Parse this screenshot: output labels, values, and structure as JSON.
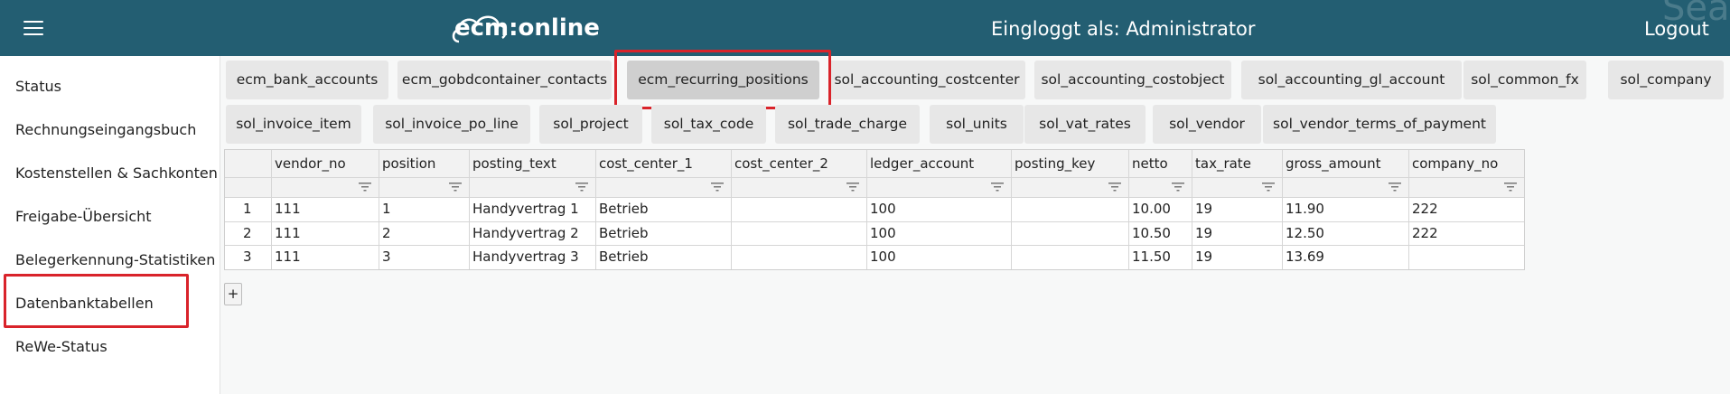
{
  "header": {
    "logo_text": "ecm:online",
    "logged_in": "Eingloggt als: Administrator",
    "logout_label": "Logout",
    "watermark": "Searchin"
  },
  "sidebar": {
    "items": [
      {
        "label": "Status"
      },
      {
        "label": "Rechnungseingangsbuch"
      },
      {
        "label": "Kostenstellen & Sachkonten"
      },
      {
        "label": "Freigabe-Übersicht"
      },
      {
        "label": "Belegerkennung-Statistiken"
      },
      {
        "label": "Datenbanktabellen"
      },
      {
        "label": "ReWe-Status"
      }
    ]
  },
  "tabs": {
    "row1": [
      {
        "label": "ecm_bank_accounts"
      },
      {
        "label": "ecm_gobdcontainer_contacts"
      },
      {
        "label": "ecm_recurring_positions"
      },
      {
        "label": "sol_accounting_costcenter"
      },
      {
        "label": "sol_accounting_costobject"
      },
      {
        "label": "sol_accounting_gl_account"
      },
      {
        "label": "sol_common_fx"
      },
      {
        "label": "sol_company"
      }
    ],
    "row2": [
      {
        "label": "sol_invoice_item"
      },
      {
        "label": "sol_invoice_po_line"
      },
      {
        "label": "sol_project"
      },
      {
        "label": "sol_tax_code"
      },
      {
        "label": "sol_trade_charge"
      },
      {
        "label": "sol_units"
      },
      {
        "label": "sol_vat_rates"
      },
      {
        "label": "sol_vendor"
      },
      {
        "label": "sol_vendor_terms_of_payment"
      }
    ],
    "active": "ecm_recurring_positions"
  },
  "table": {
    "columns": [
      "vendor_no",
      "position",
      "posting_text",
      "cost_center_1",
      "cost_center_2",
      "ledger_account",
      "posting_key",
      "netto",
      "tax_rate",
      "gross_amount",
      "company_no"
    ],
    "rows": [
      {
        "idx": "1",
        "cells": [
          "111",
          "1",
          "Handyvertrag 1",
          "Betrieb",
          "",
          "100",
          "",
          "10.00",
          "19",
          "11.90",
          "222"
        ]
      },
      {
        "idx": "2",
        "cells": [
          "111",
          "2",
          "Handyvertrag 2",
          "Betrieb",
          "",
          "100",
          "",
          "10.50",
          "19",
          "12.50",
          "222"
        ]
      },
      {
        "idx": "3",
        "cells": [
          "111",
          "3",
          "Handyvertrag 3",
          "Betrieb",
          "",
          "100",
          "",
          "11.50",
          "19",
          "13.69",
          ""
        ]
      }
    ],
    "add_label": "+"
  },
  "colors": {
    "header_bg": "#235e72",
    "highlight": "#d9232a",
    "tab_bg": "#e7e7e7",
    "tab_active_bg": "#cfcfcf"
  },
  "icons": {
    "menu": "hamburger-icon",
    "filter": "filter-icon"
  }
}
